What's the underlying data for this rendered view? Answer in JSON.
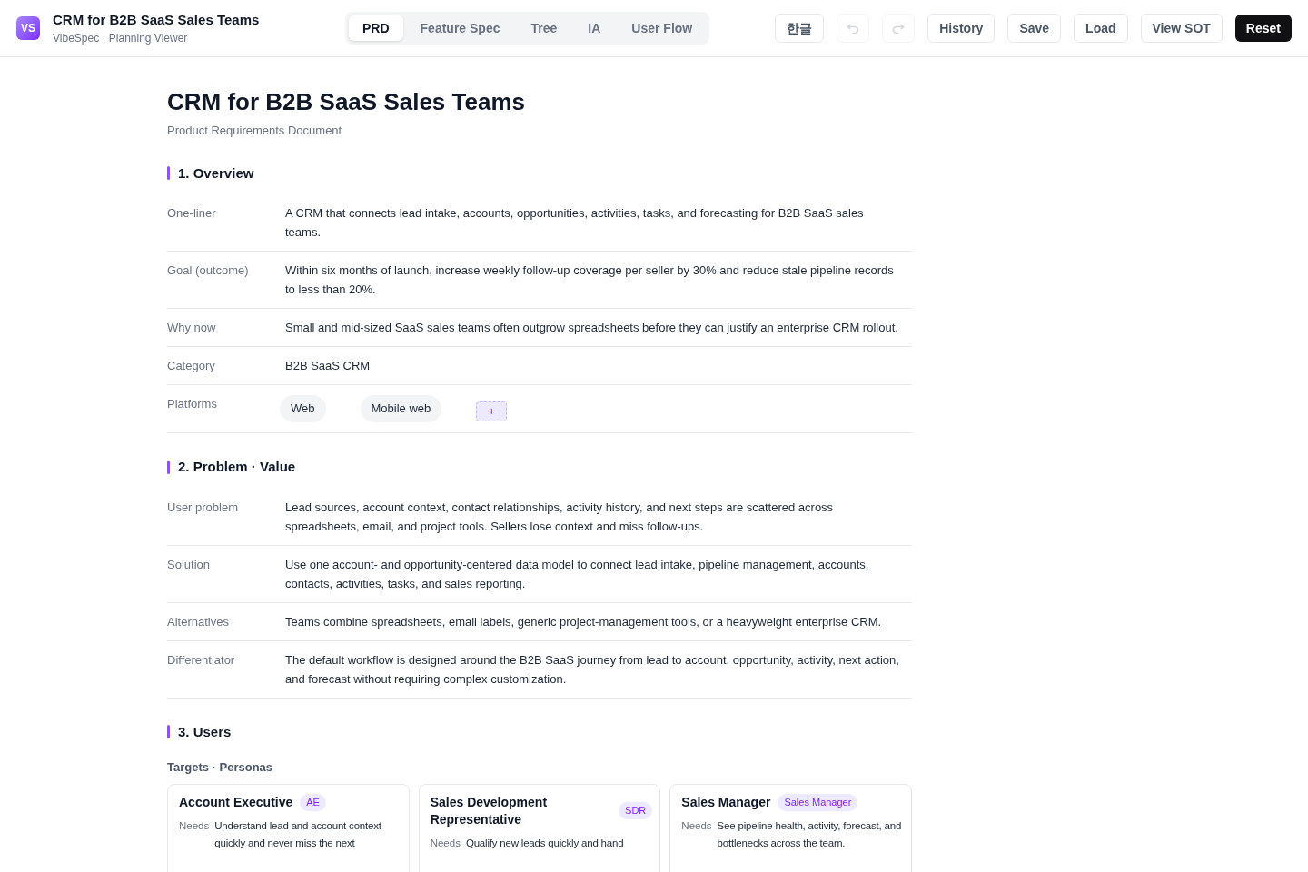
{
  "header": {
    "logo": "VS",
    "title": "CRM for B2B SaaS Sales Teams",
    "subtitle": "VibeSpec · Planning Viewer"
  },
  "tabs": [
    {
      "label": "PRD",
      "selected": true
    },
    {
      "label": "Feature Spec",
      "selected": false
    },
    {
      "label": "Tree",
      "selected": false
    },
    {
      "label": "IA",
      "selected": false
    },
    {
      "label": "User Flow",
      "selected": false
    }
  ],
  "actions": [
    {
      "kind": "text",
      "label": "한글",
      "disabled": false
    },
    {
      "kind": "undo",
      "disabled": true
    },
    {
      "kind": "redo",
      "disabled": true
    },
    {
      "kind": "text",
      "label": "History",
      "disabled": false
    },
    {
      "kind": "text",
      "label": "Save",
      "disabled": false
    },
    {
      "kind": "text",
      "label": "Load",
      "disabled": false
    },
    {
      "kind": "text",
      "label": "View SOT",
      "disabled": false
    },
    {
      "kind": "primary",
      "label": "Reset",
      "disabled": false
    }
  ],
  "document": {
    "title": "CRM for B2B SaaS Sales Teams",
    "subtitle": "Product Requirements Document",
    "sections": [
      {
        "title": "1. Overview",
        "rows": [
          {
            "kind": "text",
            "label": "One-liner",
            "value": "A CRM that connects lead intake, accounts, opportunities, activities, tasks, and forecasting for B2B SaaS sales teams."
          },
          {
            "kind": "text",
            "label": "Goal (outcome)",
            "value": "Within six months of launch, increase weekly follow-up coverage per seller by 30% and reduce stale pipeline records to less than 20%."
          },
          {
            "kind": "text",
            "label": "Why now",
            "value": "Small and mid-sized SaaS sales teams often outgrow spreadsheets before they can justify an enterprise CRM rollout."
          },
          {
            "kind": "text",
            "label": "Category",
            "value": "B2B SaaS CRM"
          },
          {
            "kind": "chips",
            "label": "Platforms",
            "chips": [
              "Web",
              "Mobile web"
            ],
            "add": "+"
          }
        ]
      },
      {
        "title": "2. Problem · Value",
        "rows": [
          {
            "kind": "text",
            "label": "User problem",
            "value": "Lead sources, account context, contact relationships, activity history, and next steps are scattered across spreadsheets, email, and project tools. Sellers lose context and miss follow-ups."
          },
          {
            "kind": "text",
            "label": "Solution",
            "value": "Use one account- and opportunity-centered data model to connect lead intake, pipeline management, accounts, contacts, activities, tasks, and sales reporting."
          },
          {
            "kind": "text",
            "label": "Alternatives",
            "value": "Teams combine spreadsheets, email labels, generic project-management tools, or a heavyweight enterprise CRM."
          },
          {
            "kind": "text",
            "label": "Differentiator",
            "value": "The default workflow is designed around the B2B SaaS journey from lead to account, opportunity, activity, next action, and forecast without requiring complex customization."
          }
        ]
      },
      {
        "title": "3. Users",
        "subheading": "Targets · Personas",
        "personas": [
          {
            "name": "Account Executive",
            "tag": "AE",
            "needs_label": "Needs",
            "needs": "Understand lead and account context quickly and never miss the next"
          },
          {
            "name": "Sales Development Representative",
            "tag": "SDR",
            "needs_label": "Needs",
            "needs": "Qualify new leads quickly and hand"
          },
          {
            "name": "Sales Manager",
            "tag": "Sales Manager",
            "needs_label": "Needs",
            "needs": "See pipeline health, activity, forecast, and bottlenecks across the team."
          }
        ]
      }
    ]
  }
}
